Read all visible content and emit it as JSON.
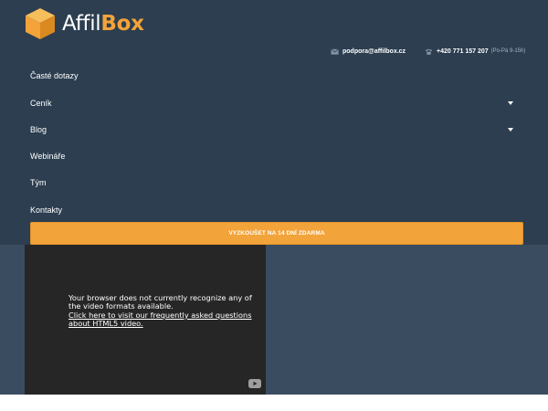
{
  "brand": {
    "name_part1": "Affil",
    "name_part2": "Box",
    "accent": "#f2a33a"
  },
  "contact": {
    "email": "podpora@affilbox.cz",
    "phone": "+420 771 157 207",
    "hours": "(Po-Pá 9-15h)"
  },
  "nav": {
    "items": [
      {
        "label": "Časté dotazy",
        "has_submenu": false
      },
      {
        "label": "Ceník",
        "has_submenu": true
      },
      {
        "label": "Blog",
        "has_submenu": true
      },
      {
        "label": "Webináře",
        "has_submenu": false
      },
      {
        "label": "Tým",
        "has_submenu": false
      },
      {
        "label": "Kontakty",
        "has_submenu": false
      }
    ],
    "cta_label": "VYZKOUŠET NA 14 DNÍ ZDARMA"
  },
  "video": {
    "message": "Your browser does not currently recognize any of the video formats available.",
    "link_text": "Click here to visit our frequently asked questions about HTML5 video."
  },
  "colors": {
    "header_bg": "#2c3e50",
    "hero_bg": "#3a4c60",
    "video_bg": "#262626"
  }
}
